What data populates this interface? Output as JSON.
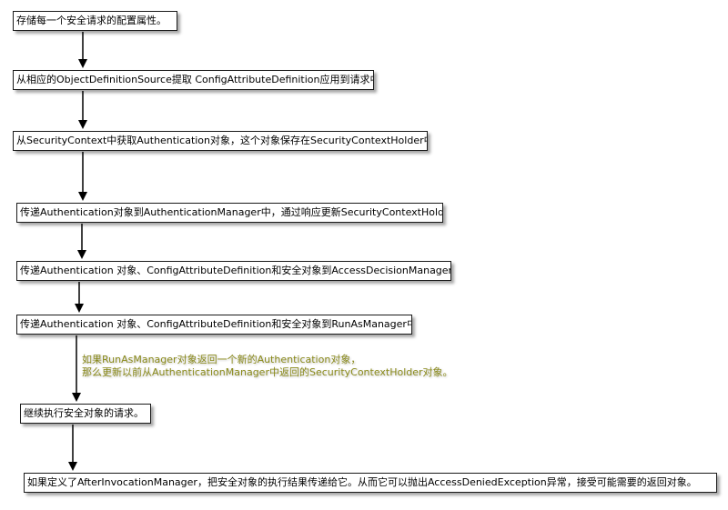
{
  "steps": [
    "存储每一个安全请求的配置属性。",
    "从相应的ObjectDefinitionSource提取 ConfigAttributeDefinition应用到请求中。",
    "从SecurityContext中获取Authentication对象，这个对象保存在SecurityContextHolder中。",
    "传递Authentication对象到AuthenticationManager中，通过响应更新SecurityContextHolder。",
    "传递Authentication 对象、ConfigAttributeDefinition和安全对象到AccessDecisionManager中。",
    "传递Authentication 对象、ConfigAttributeDefinition和安全对象到RunAsManager中。",
    "继续执行安全对象的请求。",
    "如果定义了AfterInvocationManager，把安全对象的执行结果传递给它。从而它可以抛出AccessDeniedException异常，接受可能需要的返回对象。"
  ],
  "note": {
    "line1": "如果RunAsManager对象返回一个新的Authentication对象，",
    "line2": "那么更新以前从AuthenticationManager中返回的SecurityContextHolder对象。",
    "color": "#8a8a1a"
  }
}
